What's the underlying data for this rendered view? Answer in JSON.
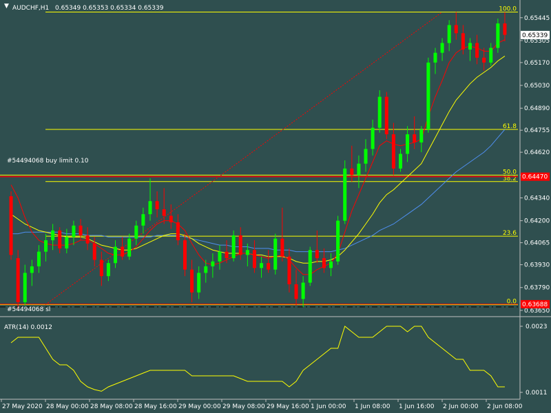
{
  "header": {
    "symbol": "AUDCHF,H1",
    "ohlc": "0.65349 0.65353 0.65334 0.65339"
  },
  "orders": {
    "buy_limit_label": "#54494068 buy limit 0.10",
    "buy_limit_price": "0.64470",
    "sl_label": "#54494068 sl",
    "sl_price": "0.63688"
  },
  "current_price": "0.65339",
  "colors": {
    "background": "#2f4f4f",
    "bull_candle": "#00ff00",
    "bear_candle": "#ff0000",
    "fib_lines": "#ffff00",
    "order_line": "#ff0000",
    "ma_fast": "#ff0000",
    "ma_mid": "#ffff00",
    "ma_slow": "#4f8ff0",
    "atr_line": "#ffff00",
    "text": "#ffffff"
  },
  "chart_data": [
    {
      "type": "candlestick",
      "symbol": "AUDCHF",
      "timeframe": "H1",
      "y_ticks": [
        "0.65445",
        "0.65305",
        "0.65170",
        "0.65030",
        "0.64890",
        "0.64755",
        "0.64620",
        "0.64480",
        "0.64340",
        "0.64200",
        "0.64065",
        "0.63930",
        "0.63790",
        "0.63650"
      ],
      "ylim": [
        0.6362,
        0.6552
      ],
      "x_ticks": [
        "27 May 2020",
        "28 May 00:00",
        "28 May 08:00",
        "28 May 16:00",
        "29 May 00:00",
        "29 May 08:00",
        "29 May 16:00",
        "1 Jun 00:00",
        "1 Jun 08:00",
        "1 Jun 16:00",
        "2 Jun 00:00",
        "2 Jun 08:00"
      ],
      "fibonacci": {
        "levels": [
          "100.0",
          "61.8",
          "50.0",
          "38.2",
          "23.6",
          "0.0"
        ],
        "values": [
          0.6548,
          0.6476,
          0.6448,
          0.6444,
          0.64105,
          0.63685
        ]
      },
      "candles": [
        [
          0.6435,
          0.6438,
          0.6396,
          0.6399
        ],
        [
          0.6397,
          0.6402,
          0.6366,
          0.637
        ],
        [
          0.637,
          0.6393,
          0.6368,
          0.6388
        ],
        [
          0.6388,
          0.6396,
          0.638,
          0.6392
        ],
        [
          0.6392,
          0.6405,
          0.6388,
          0.6401
        ],
        [
          0.6401,
          0.6412,
          0.6395,
          0.6408
        ],
        [
          0.6408,
          0.6418,
          0.6402,
          0.6414
        ],
        [
          0.6414,
          0.6416,
          0.64,
          0.6403
        ],
        [
          0.6403,
          0.6415,
          0.64,
          0.641
        ],
        [
          0.641,
          0.642,
          0.6405,
          0.6417
        ],
        [
          0.6417,
          0.6421,
          0.6408,
          0.6411
        ],
        [
          0.6411,
          0.6416,
          0.6402,
          0.6406
        ],
        [
          0.6406,
          0.641,
          0.6392,
          0.6396
        ],
        [
          0.6396,
          0.6401,
          0.638,
          0.6386
        ],
        [
          0.6386,
          0.6396,
          0.6383,
          0.6394
        ],
        [
          0.6394,
          0.6408,
          0.6391,
          0.6404
        ],
        [
          0.6404,
          0.641,
          0.6396,
          0.6398
        ],
        [
          0.6398,
          0.6412,
          0.6396,
          0.6409
        ],
        [
          0.6409,
          0.642,
          0.6405,
          0.6417
        ],
        [
          0.6417,
          0.6428,
          0.6412,
          0.6424
        ],
        [
          0.6424,
          0.6446,
          0.642,
          0.6432
        ],
        [
          0.6432,
          0.6438,
          0.6422,
          0.6427
        ],
        [
          0.6427,
          0.644,
          0.6418,
          0.6423
        ],
        [
          0.6423,
          0.643,
          0.6415,
          0.6419
        ],
        [
          0.6419,
          0.6424,
          0.6405,
          0.6408
        ],
        [
          0.6408,
          0.6412,
          0.6386,
          0.639
        ],
        [
          0.639,
          0.6396,
          0.637,
          0.6376
        ],
        [
          0.6376,
          0.6392,
          0.6372,
          0.6388
        ],
        [
          0.6388,
          0.6396,
          0.6382,
          0.6392
        ],
        [
          0.6392,
          0.64,
          0.6385,
          0.6395
        ],
        [
          0.6395,
          0.6405,
          0.639,
          0.6401
        ],
        [
          0.6401,
          0.6408,
          0.6394,
          0.6397
        ],
        [
          0.6397,
          0.6414,
          0.6395,
          0.6411
        ],
        [
          0.6411,
          0.6416,
          0.6396,
          0.6399
        ],
        [
          0.6399,
          0.6406,
          0.6392,
          0.6402
        ],
        [
          0.6402,
          0.6408,
          0.6388,
          0.6391
        ],
        [
          0.6391,
          0.6398,
          0.6385,
          0.6394
        ],
        [
          0.6394,
          0.6402,
          0.6388,
          0.639
        ],
        [
          0.639,
          0.6412,
          0.6387,
          0.6409
        ],
        [
          0.6409,
          0.6428,
          0.6395,
          0.6398
        ],
        [
          0.6398,
          0.6403,
          0.6376,
          0.6381
        ],
        [
          0.6381,
          0.639,
          0.6368,
          0.6372
        ],
        [
          0.6372,
          0.6386,
          0.6367,
          0.6382
        ],
        [
          0.6382,
          0.6404,
          0.638,
          0.6402
        ],
        [
          0.6402,
          0.6414,
          0.6394,
          0.6397
        ],
        [
          0.6397,
          0.6403,
          0.6388,
          0.6391
        ],
        [
          0.6391,
          0.64,
          0.6386,
          0.6395
        ],
        [
          0.6395,
          0.6423,
          0.6393,
          0.642
        ],
        [
          0.642,
          0.6457,
          0.6418,
          0.6452
        ],
        [
          0.6452,
          0.6466,
          0.6444,
          0.6448
        ],
        [
          0.6448,
          0.646,
          0.644,
          0.6455
        ],
        [
          0.6455,
          0.647,
          0.645,
          0.6464
        ],
        [
          0.6464,
          0.6482,
          0.646,
          0.6477
        ],
        [
          0.6477,
          0.65,
          0.6474,
          0.6496
        ],
        [
          0.6496,
          0.6499,
          0.647,
          0.6473
        ],
        [
          0.6473,
          0.648,
          0.6448,
          0.6452
        ],
        [
          0.6452,
          0.6464,
          0.645,
          0.6461
        ],
        [
          0.6461,
          0.6478,
          0.6456,
          0.6473
        ],
        [
          0.6473,
          0.6484,
          0.6464,
          0.6468
        ],
        [
          0.6468,
          0.6478,
          0.6462,
          0.6476
        ],
        [
          0.6476,
          0.652,
          0.6474,
          0.6517
        ],
        [
          0.6517,
          0.6526,
          0.651,
          0.6523
        ],
        [
          0.6523,
          0.6532,
          0.6518,
          0.6529
        ],
        [
          0.6529,
          0.6543,
          0.6524,
          0.654
        ],
        [
          0.654,
          0.6548,
          0.6531,
          0.6535
        ],
        [
          0.6535,
          0.654,
          0.6522,
          0.6525
        ],
        [
          0.6525,
          0.6532,
          0.6518,
          0.6529
        ],
        [
          0.6529,
          0.6534,
          0.6516,
          0.652
        ],
        [
          0.652,
          0.6526,
          0.6512,
          0.6517
        ],
        [
          0.6517,
          0.6529,
          0.6515,
          0.6526
        ],
        [
          0.6526,
          0.6544,
          0.6523,
          0.6541
        ],
        [
          0.6541,
          0.6548,
          0.653,
          0.6534
        ]
      ],
      "ma_fast": [
        0.6442,
        0.6434,
        0.6422,
        0.6413,
        0.6408,
        0.6406,
        0.6405,
        0.6405,
        0.6405,
        0.6406,
        0.6408,
        0.6408,
        0.6406,
        0.6403,
        0.64,
        0.6399,
        0.6399,
        0.6401,
        0.6404,
        0.6409,
        0.6414,
        0.6418,
        0.642,
        0.642,
        0.6418,
        0.6414,
        0.6406,
        0.6399,
        0.6394,
        0.6393,
        0.6394,
        0.6396,
        0.6398,
        0.64,
        0.64,
        0.6399,
        0.6398,
        0.6397,
        0.6398,
        0.6399,
        0.6396,
        0.6391,
        0.6387,
        0.6387,
        0.639,
        0.6392,
        0.6394,
        0.64,
        0.6413,
        0.6426,
        0.6436,
        0.6446,
        0.6456,
        0.6466,
        0.6469,
        0.6467,
        0.6466,
        0.6467,
        0.6468,
        0.647,
        0.6484,
        0.6496,
        0.6506,
        0.6517,
        0.6523,
        0.6526,
        0.6527,
        0.6526,
        0.6524,
        0.6524,
        0.6529,
        0.6531
      ],
      "ma_mid": [
        0.6424,
        0.6421,
        0.6418,
        0.6416,
        0.6414,
        0.6413,
        0.6412,
        0.6411,
        0.641,
        0.641,
        0.641,
        0.6409,
        0.6407,
        0.6405,
        0.6404,
        0.6403,
        0.6402,
        0.6402,
        0.6403,
        0.6405,
        0.6407,
        0.6409,
        0.6411,
        0.6412,
        0.6412,
        0.6411,
        0.6409,
        0.6406,
        0.6404,
        0.6402,
        0.6401,
        0.64,
        0.64,
        0.64,
        0.64,
        0.6399,
        0.6399,
        0.6398,
        0.6398,
        0.6398,
        0.6397,
        0.6395,
        0.6394,
        0.6394,
        0.6395,
        0.6395,
        0.6396,
        0.6398,
        0.6402,
        0.6407,
        0.6412,
        0.6418,
        0.6424,
        0.6431,
        0.6436,
        0.6439,
        0.6443,
        0.6447,
        0.6451,
        0.6455,
        0.6463,
        0.6471,
        0.6479,
        0.6487,
        0.6494,
        0.6499,
        0.6504,
        0.6508,
        0.6511,
        0.6514,
        0.6518,
        0.6521
      ],
      "ma_slow": [
        0.6412,
        0.6412,
        0.6413,
        0.6413,
        0.6413,
        0.6413,
        0.6413,
        0.6413,
        0.6412,
        0.6412,
        0.6412,
        0.6411,
        0.6411,
        0.6411,
        0.641,
        0.641,
        0.641,
        0.641,
        0.641,
        0.641,
        0.641,
        0.6411,
        0.6411,
        0.6411,
        0.6411,
        0.641,
        0.6409,
        0.6408,
        0.6407,
        0.6406,
        0.6405,
        0.6405,
        0.6404,
        0.6404,
        0.6404,
        0.6403,
        0.6403,
        0.6403,
        0.6402,
        0.6402,
        0.6402,
        0.6401,
        0.6401,
        0.6401,
        0.6401,
        0.6401,
        0.6401,
        0.6402,
        0.6403,
        0.6405,
        0.6407,
        0.6409,
        0.6411,
        0.6414,
        0.6416,
        0.6418,
        0.6421,
        0.6424,
        0.6427,
        0.643,
        0.6434,
        0.6438,
        0.6442,
        0.6446,
        0.645,
        0.6453,
        0.6456,
        0.6459,
        0.6462,
        0.6466,
        0.6471,
        0.6476
      ]
    },
    {
      "type": "line",
      "title": "ATR(14) 0.0012",
      "y_ticks": [
        "0.0023",
        "0.0011"
      ],
      "ylim": [
        0.001,
        0.0024
      ],
      "values": [
        0.002,
        0.0021,
        0.0021,
        0.0021,
        0.0021,
        0.0019,
        0.0017,
        0.0016,
        0.0016,
        0.0015,
        0.0013,
        0.0012,
        0.00115,
        0.00112,
        0.0012,
        0.00125,
        0.0013,
        0.00135,
        0.0014,
        0.00145,
        0.0015,
        0.0015,
        0.0015,
        0.0015,
        0.0015,
        0.0015,
        0.0014,
        0.0014,
        0.0014,
        0.0014,
        0.0014,
        0.0014,
        0.0014,
        0.00135,
        0.0013,
        0.0013,
        0.0013,
        0.0013,
        0.0013,
        0.0013,
        0.0012,
        0.0013,
        0.0015,
        0.0016,
        0.0017,
        0.0018,
        0.0019,
        0.0019,
        0.0023,
        0.0022,
        0.0021,
        0.0021,
        0.0021,
        0.0022,
        0.0023,
        0.0023,
        0.0023,
        0.0022,
        0.0023,
        0.0023,
        0.0021,
        0.002,
        0.0019,
        0.0018,
        0.0017,
        0.0017,
        0.0015,
        0.0015,
        0.0015,
        0.0014,
        0.0012,
        0.0012
      ]
    }
  ]
}
